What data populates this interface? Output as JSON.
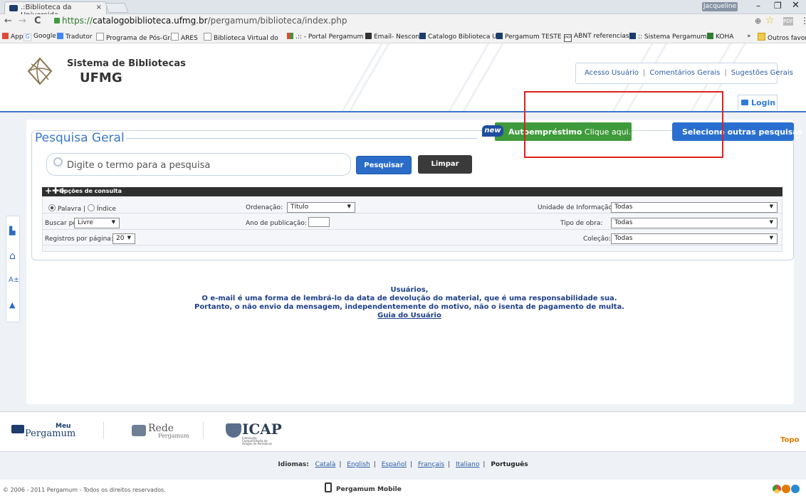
{
  "browser": {
    "tab_title": ".:Biblioteca da Universida",
    "tab_close": "×",
    "user_chip": "Jacqueline",
    "window_min": "–",
    "window_max": "❐",
    "window_close": "✕",
    "nav_back": "←",
    "nav_forward": "→",
    "nav_reload": "C",
    "url_scheme": "https://",
    "url_host": "catalogobiblioteca.ufmg.br",
    "url_path": "/pergamum/biblioteca/index.php",
    "zoom_icon": "⊕",
    "star_icon": "☆",
    "pdf_icon": "PDF",
    "menu_icon": "⋮",
    "bookmarks": [
      {
        "label": "Apps",
        "icon": "apps-icon"
      },
      {
        "label": "Google",
        "icon": "google-icon"
      },
      {
        "label": "Tradutor",
        "icon": "translate-icon"
      },
      {
        "label": "Programa de Pós-Gra",
        "icon": "page-icon"
      },
      {
        "label": "ARES",
        "icon": "page-icon"
      },
      {
        "label": "Biblioteca Virtual do",
        "icon": "page-icon"
      },
      {
        "label": ".:: - Portal Pergamum",
        "icon": "pergamum-icon"
      },
      {
        "label": "Email- Nescon",
        "icon": "email-icon"
      },
      {
        "label": "Catalogo Biblioteca U",
        "icon": "pergamum-icon"
      },
      {
        "label": "Pergamum TESTE",
        "icon": "pergamum-icon"
      },
      {
        "label": "ABNT referencias",
        "icon": "pkp-icon"
      },
      {
        "label": ":: Sistema Pergamum",
        "icon": "pergamum-icon"
      },
      {
        "label": "KOHA",
        "icon": "koha-icon"
      },
      {
        "label": "»",
        "icon": ""
      },
      {
        "label": "Outros favorito",
        "icon": "folder-icon"
      }
    ]
  },
  "header": {
    "title_line1": "Sistema de Bibliotecas",
    "title_line2": "UFMG",
    "links": [
      "Acesso Usuário",
      "Comentários Gerais",
      "Sugestões Gerais"
    ],
    "separator": "|",
    "login": "Login"
  },
  "search": {
    "title": "Pesquisa Geral",
    "new_badge": "new",
    "auto_bold": "Autoempréstimo",
    "auto_rest": " Clique aqui.",
    "other_searches": "Selecione outras pesquisas",
    "other_arrow": "▾",
    "placeholder": "Digite o termo para a pesquisa",
    "btn_search": "Pesquisar",
    "btn_clear": "Limpar",
    "options_label": "Opções de consulta",
    "options_plus": "+✚+",
    "radio_word": "Palavra",
    "radio_sep": "|",
    "radio_index": "Índice",
    "buscar_label": "Buscar por:",
    "buscar_value": "Livre",
    "registros_label": "Registros por página:",
    "registros_value": "20",
    "ordenacao_label": "Ordenação:",
    "ordenacao_value": "Título",
    "ano_label": "Ano de publicação:",
    "unidade_label": "Unidade de Informação:",
    "unidade_value": "Todas",
    "tipo_label": "Tipo de obra:",
    "tipo_value": "Todas",
    "colecao_label": "Coleção:",
    "colecao_value": "Todas",
    "select_arrow": "▼"
  },
  "sidebar": {
    "items": [
      {
        "name": "meu-pergamum-icon",
        "glyph": "▙"
      },
      {
        "name": "home-icon",
        "glyph": "⌂"
      },
      {
        "name": "font-size-icon",
        "glyph": "A±"
      },
      {
        "name": "up-arrow-icon",
        "glyph": "▲"
      }
    ]
  },
  "notice": {
    "line1": "Usuários,",
    "line2": "O e-mail é uma forma de lembrá-lo da data de devolução do material, que é uma responsabilidade sua.",
    "line3": "Portanto, o não envio da mensagem, independentemente do motivo, não o isenta de pagamento de multa.",
    "link": "Guia do Usuário"
  },
  "footer": {
    "meu": "Meu",
    "pergamum": "Pergamum",
    "rede": "Rede",
    "rede_sub": "Pergamum",
    "icap": "ICAP",
    "icap_sub": "Indexação Compartilhada de Artigos de Periódicos",
    "topo": "Topo",
    "idiomas_label": "Idiomas:",
    "languages": [
      "Català",
      "English",
      "Español",
      "Français",
      "Italiano"
    ],
    "current_language": "Português",
    "copyright": "© 2006 - 2011 Pergamum - Todos os direitos reservados.",
    "mobile": "Pergamum Mobile"
  },
  "colors": {
    "accent_blue": "#2a6fd0",
    "green": "#3e9a3a",
    "highlight_red": "#e02020",
    "topo_orange": "#e07a00"
  }
}
